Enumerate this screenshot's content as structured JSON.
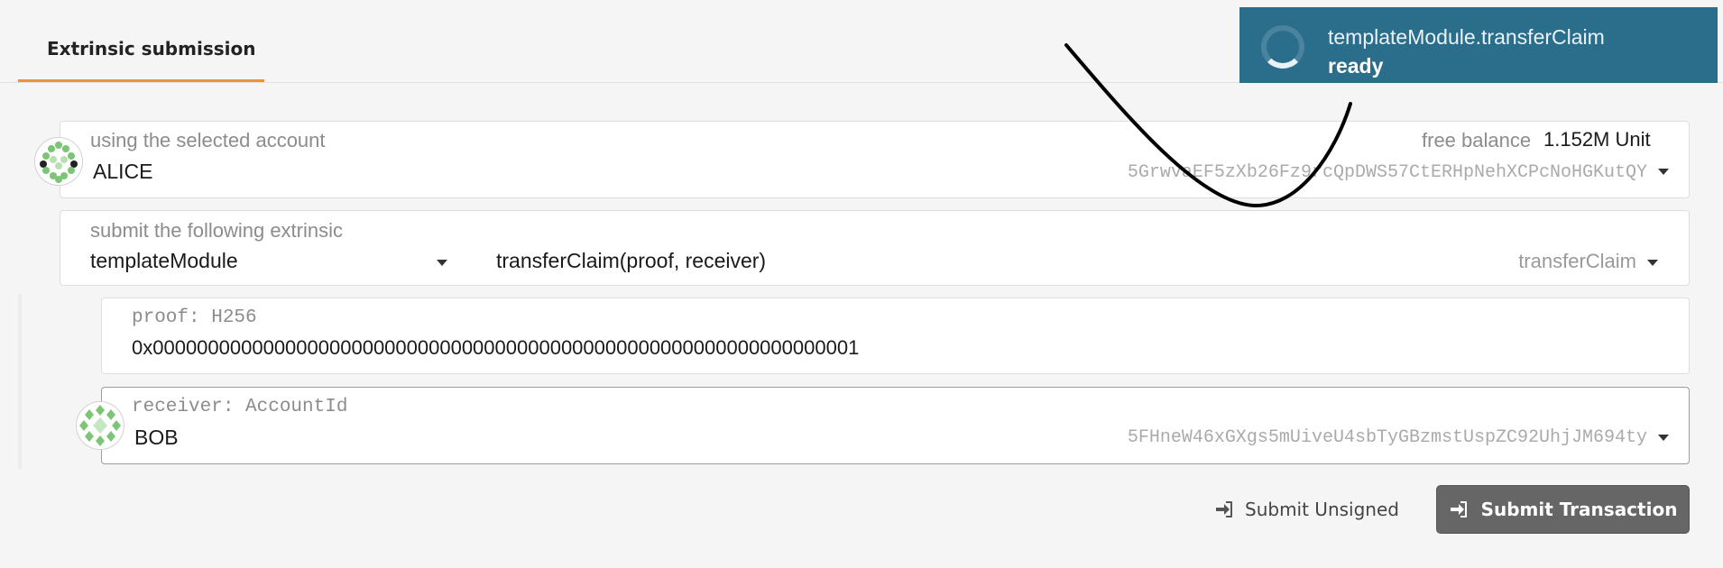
{
  "tabs": [
    {
      "label": "Extrinsic submission",
      "active": true
    }
  ],
  "account": {
    "label": "using the selected account",
    "name": "ALICE",
    "address": "5GrwvaEF5zXb26Fz9rcQpDWS57CtERHpNehXCPcNoHGKutQY",
    "balance_label": "free balance",
    "balance_value": "1.152M Unit"
  },
  "extrinsic": {
    "label": "submit the following extrinsic",
    "module": "templateModule",
    "call_signature": "transferClaim(proof, receiver)",
    "call_method": "transferClaim"
  },
  "params": {
    "proof": {
      "label": "proof: H256",
      "value": "0x0000000000000000000000000000000000000000000000000000000000000001"
    },
    "receiver": {
      "label": "receiver: AccountId",
      "name": "BOB",
      "address": "5FHneW46xGXgs5mUiveU4sbTyGBzmstUspZC92UhjJM694ty"
    }
  },
  "actions": {
    "submit_unsigned": "Submit Unsigned",
    "submit_transaction": "Submit Transaction"
  },
  "toast": {
    "title": "templateModule.transferClaim",
    "status": "ready"
  },
  "colors": {
    "accent": "#f19135",
    "toast_bg": "#2b6e8c",
    "primary_button": "#666666",
    "identicon_green": "#7cc576"
  },
  "icons": {
    "submit_unsigned": "sign-in-icon",
    "submit_transaction": "sign-in-icon",
    "caret": "caret-down-icon",
    "spinner": "spinner-icon"
  }
}
